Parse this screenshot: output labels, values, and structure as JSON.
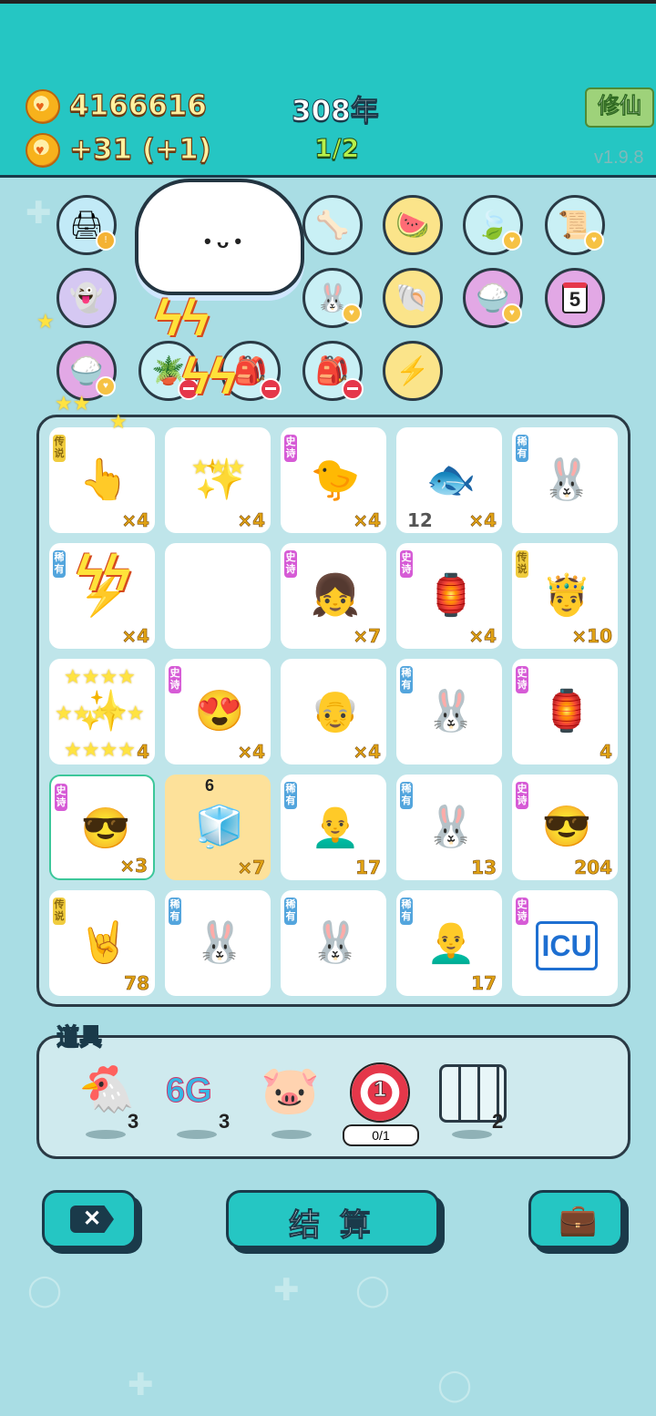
{
  "header": {
    "coins": "4166616",
    "income": "+31",
    "income_bonus": "(+1)",
    "year": "308年",
    "progress": "1/2",
    "cultivate_button": "修仙",
    "version": "v1.9.8"
  },
  "relic_rows": [
    [
      "printer-icon",
      "cloud-icon",
      "cloud-icon",
      "pet-bowl-icon",
      "fruit-plate-icon",
      "leaf-icon",
      "scroll-icon"
    ],
    [
      "ghost-icon",
      "cloud-icon",
      "cloud-icon",
      "rabbit-icon",
      "shell-icon",
      "rice-bowl-icon",
      "calendar-icon"
    ],
    [
      "rice-bowl-icon",
      "plant-icon",
      "sack-icon",
      "sack-icon",
      "lightning-icon"
    ]
  ],
  "relic_calendar_day": "5",
  "board": {
    "rows": [
      [
        {
          "tag": "传说",
          "count": "×4",
          "icon": "pointing-hand-icon"
        },
        {
          "tag": "",
          "count": "×4",
          "icon": "star-burst-icon"
        },
        {
          "tag": "史诗",
          "count": "×4",
          "icon": "chick-icon"
        },
        {
          "tag": "",
          "count": "×4",
          "left_count": "12",
          "icon": "fish-icon"
        },
        {
          "tag": "稀有",
          "count": "",
          "icon": "rabbit-icon"
        }
      ],
      [
        {
          "tag": "稀有",
          "count": "×4",
          "icon": "lightning-icon"
        },
        {
          "tag": "",
          "count": "",
          "icon": ""
        },
        {
          "tag": "史诗",
          "count": "×7",
          "icon": "girl-face-icon"
        },
        {
          "tag": "史诗",
          "count": "×4",
          "icon": "rabbit-house-icon"
        },
        {
          "tag": "传说",
          "count": "×10",
          "icon": "king-face-icon"
        }
      ],
      [
        {
          "tag": "",
          "count": "4",
          "icon": "star-burst-icon"
        },
        {
          "tag": "史诗",
          "count": "×4",
          "icon": "heart-eyes-face-icon"
        },
        {
          "tag": "",
          "count": "×4",
          "icon": "glasses-grandpa-icon"
        },
        {
          "tag": "稀有",
          "count": "",
          "icon": "rabbit-icon"
        },
        {
          "tag": "史诗",
          "count": "4",
          "icon": "rabbit-house-icon"
        }
      ],
      [
        {
          "tag": "史诗",
          "count": "×3",
          "icon": "green-hair-face-icon",
          "selected": true
        },
        {
          "tag": "",
          "count": "×7",
          "icon": "fridge-icon",
          "highlight": true,
          "overlay": "6"
        },
        {
          "tag": "稀有",
          "count": "17",
          "icon": "bald-face-icon"
        },
        {
          "tag": "稀有",
          "count": "13",
          "icon": "rabbit-icon"
        },
        {
          "tag": "史诗",
          "count": "204",
          "icon": "green-hair-face-icon"
        }
      ],
      [
        {
          "tag": "传说",
          "count": "78",
          "icon": "rock-hand-icon"
        },
        {
          "tag": "稀有",
          "count": "",
          "icon": "rabbit-icon"
        },
        {
          "tag": "稀有",
          "count": "",
          "icon": "rabbit-icon"
        },
        {
          "tag": "稀有",
          "count": "17",
          "icon": "bald-face-icon"
        },
        {
          "tag": "史诗",
          "count": "",
          "icon": "icu-sign-icon",
          "label": "ICU"
        }
      ]
    ]
  },
  "props": {
    "title": "道具",
    "items": [
      {
        "icon": "chicken-icon",
        "count": "3"
      },
      {
        "icon": "6g-icon",
        "label": "6G",
        "count": "3"
      },
      {
        "icon": "piggy-bank-icon",
        "count": ""
      },
      {
        "icon": "target-icon",
        "label": "1",
        "count": "0/1"
      },
      {
        "icon": "jars-icon",
        "count": "2"
      }
    ]
  },
  "buttons": {
    "settle_label": "结 算"
  },
  "colors": {
    "teal": "#25c6c3",
    "background": "#a9dde4",
    "epic": "#d65bd6",
    "rare": "#53a5dd",
    "legend": "#f0cc3e"
  }
}
